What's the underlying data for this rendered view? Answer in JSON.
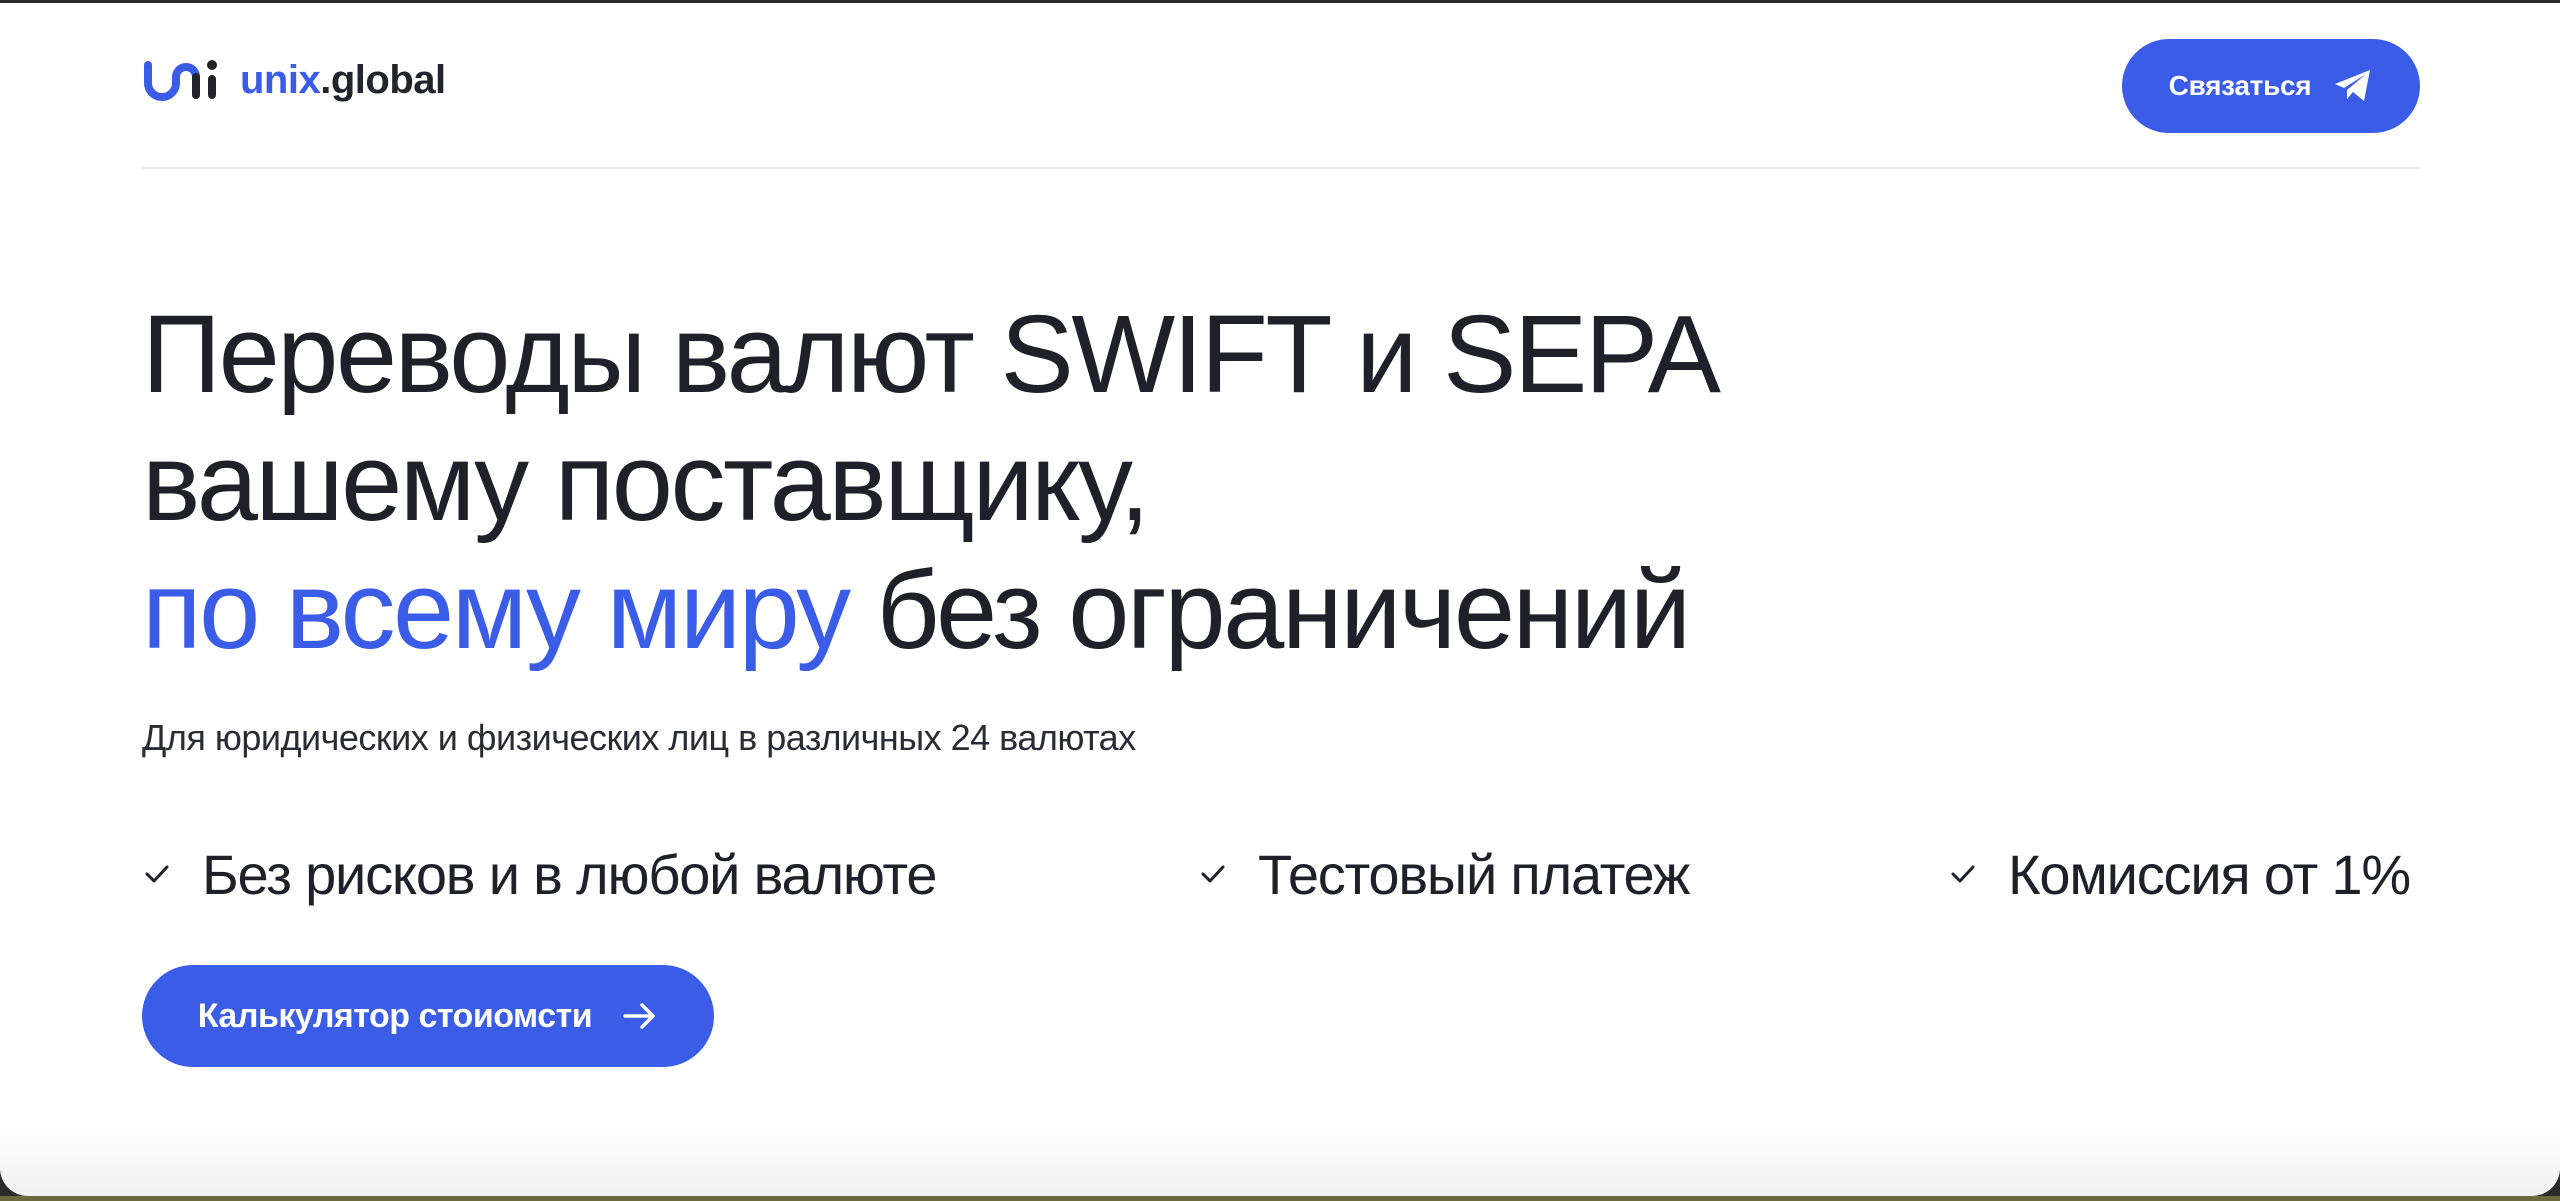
{
  "brand": {
    "logo_accent": "unix",
    "logo_rest": ".global",
    "accent_color": "#3a5ce6",
    "text_color": "#1f2029"
  },
  "header": {
    "contact_label": "Связаться",
    "contact_icon": "telegram-send-icon"
  },
  "hero": {
    "headline_line1": "Переводы валют SWIFT и SEPA",
    "headline_line2": "вашему поставщику,",
    "headline_line3_accent": "по всему миру",
    "headline_line3_rest": " без ограничений",
    "subtitle": "Для юридических и физических лиц в различных 24 валютах",
    "features": [
      {
        "icon": "check-icon",
        "label": "Без рисков и в любой валюте"
      },
      {
        "icon": "check-icon",
        "label": "Тестовый платеж"
      },
      {
        "icon": "check-icon",
        "label": "Комиссия от 1%"
      }
    ],
    "calc_label": "Калькулятор стоиомсти",
    "calc_icon": "arrow-right-icon"
  }
}
